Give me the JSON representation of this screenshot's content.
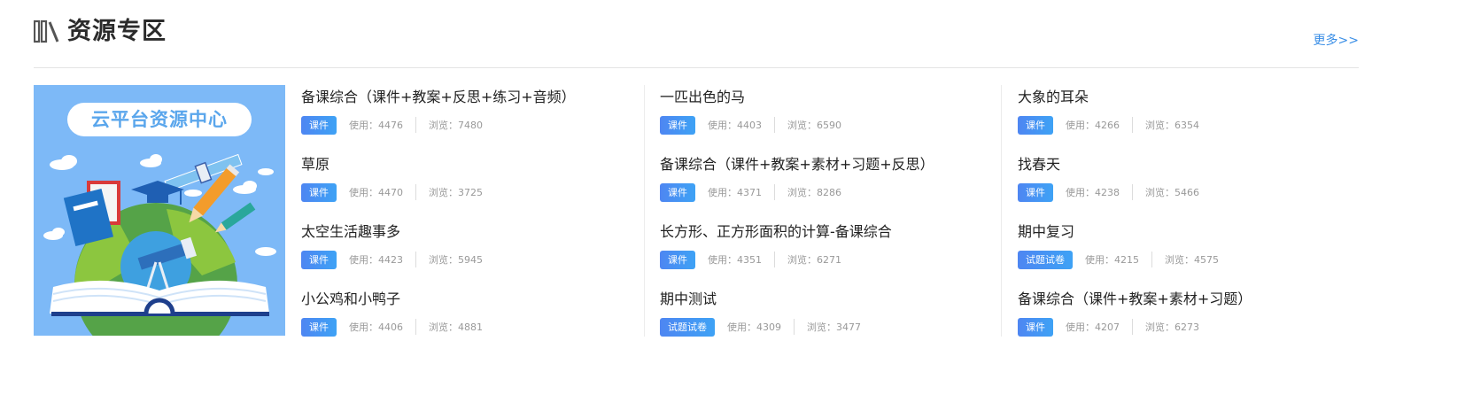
{
  "header": {
    "title": "资源专区",
    "more": "更多>>",
    "icon": "books-icon"
  },
  "banner": {
    "title": "云平台资源中心"
  },
  "columns": [
    {
      "items": [
        {
          "title": "备课综合（课件+教案+反思+练习+音频）",
          "badge": "课件",
          "use": "使用：4476",
          "view": "浏览：7480"
        },
        {
          "title": "草原",
          "badge": "课件",
          "use": "使用：4470",
          "view": "浏览：3725"
        },
        {
          "title": "太空生活趣事多",
          "badge": "课件",
          "use": "使用：4423",
          "view": "浏览：5945"
        },
        {
          "title": "小公鸡和小鸭子",
          "badge": "课件",
          "use": "使用：4406",
          "view": "浏览：4881"
        }
      ]
    },
    {
      "items": [
        {
          "title": "一匹出色的马",
          "badge": "课件",
          "use": "使用：4403",
          "view": "浏览：6590"
        },
        {
          "title": "备课综合（课件+教案+素材+习题+反思）",
          "badge": "课件",
          "use": "使用：4371",
          "view": "浏览：8286"
        },
        {
          "title": "长方形、正方形面积的计算-备课综合",
          "badge": "课件",
          "use": "使用：4351",
          "view": "浏览：6271"
        },
        {
          "title": "期中测试",
          "badge": "试题试卷",
          "use": "使用：4309",
          "view": "浏览：3477"
        }
      ]
    },
    {
      "items": [
        {
          "title": "大象的耳朵",
          "badge": "课件",
          "use": "使用：4266",
          "view": "浏览：6354"
        },
        {
          "title": "找春天",
          "badge": "课件",
          "use": "使用：4238",
          "view": "浏览：5466"
        },
        {
          "title": "期中复习",
          "badge": "试题试卷",
          "use": "使用：4215",
          "view": "浏览：4575"
        },
        {
          "title": "备课综合（课件+教案+素材+习题）",
          "badge": "课件",
          "use": "使用：4207",
          "view": "浏览：6273"
        }
      ]
    }
  ],
  "colors": {
    "accent": "#3a8ee6",
    "badge_start": "#4e86f2",
    "badge_end": "#3ea2f5",
    "banner_bg": "#7db9f7"
  }
}
